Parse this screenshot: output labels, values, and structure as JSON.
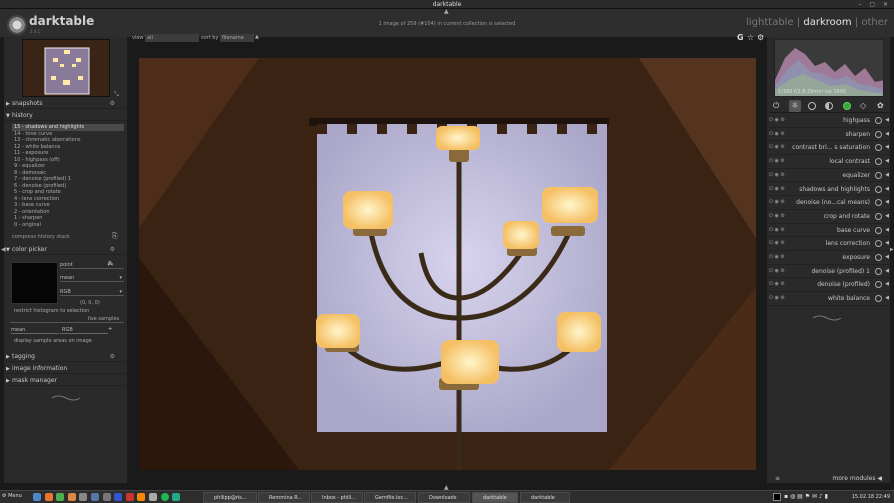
{
  "window": {
    "title": "darktable"
  },
  "app": {
    "name": "darktable",
    "version": "2.4.1"
  },
  "header": {
    "status": "1 image of 259 (#104) in current collection is selected",
    "views": [
      "lighttable",
      "darkroom",
      "other"
    ],
    "separator": "|"
  },
  "filmstrip_bar": {
    "view_label": "view",
    "view_value": "all",
    "sort_label": "sort by",
    "sort_value": "filename",
    "icons": [
      "G",
      "☆",
      "⚙"
    ]
  },
  "left": {
    "sections": {
      "snapshots": "snapshots",
      "history": "history",
      "color_picker": "color picker",
      "tagging": "tagging",
      "image_information": "image information",
      "mask_manager": "mask manager"
    },
    "history": [
      "15 - shadows and highlights",
      "14 - tone curve",
      "13 - chromatic aberrations",
      "12 - white balance",
      "11 - exposure",
      "10 - highpass (off)",
      "9 - equalizer",
      "8 - demosaic",
      "7 - denoise (profiled) 1",
      "6 - denoise (profiled)",
      "5 - crop and rotate",
      "4 - lens correction",
      "3 - base curve",
      "2 - orientation",
      "1 - sharpen",
      "0 - original"
    ],
    "compress": "compress history stack",
    "picker": {
      "mode": "point",
      "stat": "mean",
      "model": "RGB",
      "value": "(0, 0, 0)",
      "restrict": "restrict histogram to selection",
      "live": "live samples",
      "sample_stat": "mean",
      "sample_model": "RGB",
      "display": "display sample areas on image"
    }
  },
  "right": {
    "histogram_info": "1/160 f/2.8 29mm iso 1600",
    "modules": [
      "highpass",
      "sharpen",
      "contrast bri... s saturation",
      "local contrast",
      "equalizer",
      "shadows and highlights",
      "denoise (no...cal means)",
      "crop and rotate",
      "base curve",
      "lens correction",
      "exposure",
      "denoise (profiled) 1",
      "denoise (profiled)",
      "white balance"
    ],
    "more_modules": "more modules"
  },
  "taskbar": {
    "menu": "Menu",
    "tasks": [
      "philipp@ris...",
      "Remmina R...",
      "Inbox - phili...",
      "Gemfile.loc...",
      "Downloads",
      "darktable",
      "darktable"
    ],
    "clock": "15.02.18 22:49"
  },
  "colors": {
    "bg": "#1a1a1a",
    "panel": "#2a2a2a",
    "accent": "#e6e6e6"
  }
}
